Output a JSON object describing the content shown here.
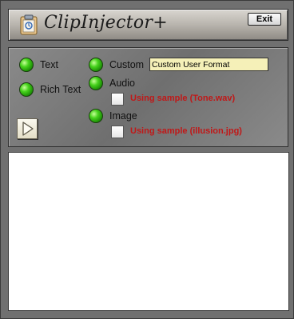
{
  "app": {
    "title": "ClipInjector+",
    "exit_label": "Exit"
  },
  "options": {
    "text": "Text",
    "rich_text": "Rich Text",
    "custom": "Custom",
    "audio": "Audio",
    "image": "Image"
  },
  "custom_format": {
    "value": "Custom User Format"
  },
  "audio_sample": {
    "label": "Using sample (Tone.wav)"
  },
  "image_sample": {
    "label": "Using sample (illusion.jpg)"
  },
  "colors": {
    "accent_red": "#c01818",
    "led_green": "#46d21c",
    "input_bg": "#f5f0b8"
  }
}
